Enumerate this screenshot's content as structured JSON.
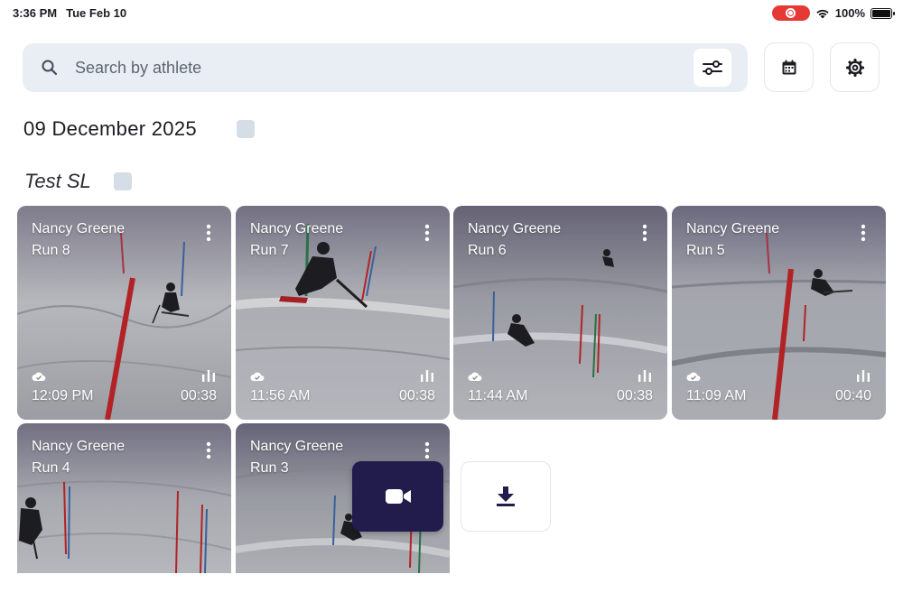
{
  "status_bar": {
    "time": "3:36 PM",
    "date": "Tue Feb 10",
    "battery": "100%"
  },
  "search": {
    "placeholder": "Search by athlete",
    "value": ""
  },
  "icons": {
    "search": "search-icon",
    "filter": "sliders-icon",
    "calendar": "calendar-icon",
    "settings": "gear-icon",
    "record": "video-camera-icon",
    "download": "download-icon"
  },
  "date_group": {
    "label": "09 December 2025"
  },
  "session": {
    "title": "Test SL"
  },
  "runs": [
    {
      "athlete": "Nancy Greene",
      "run": "Run 8",
      "time": "12:09 PM",
      "duration": "00:38"
    },
    {
      "athlete": "Nancy Greene",
      "run": "Run 7",
      "time": "11:56 AM",
      "duration": "00:38"
    },
    {
      "athlete": "Nancy Greene",
      "run": "Run 6",
      "time": "11:44 AM",
      "duration": "00:38"
    },
    {
      "athlete": "Nancy Greene",
      "run": "Run 5",
      "time": "11:09 AM",
      "duration": "00:40"
    },
    {
      "athlete": "Nancy Greene",
      "run": "Run 4"
    },
    {
      "athlete": "Nancy Greene",
      "run": "Run 3"
    }
  ],
  "colors": {
    "accent": "#221c4d",
    "search_bg": "#e9eef5",
    "checkbox": "#d5dde7",
    "recording": "#e53935"
  }
}
